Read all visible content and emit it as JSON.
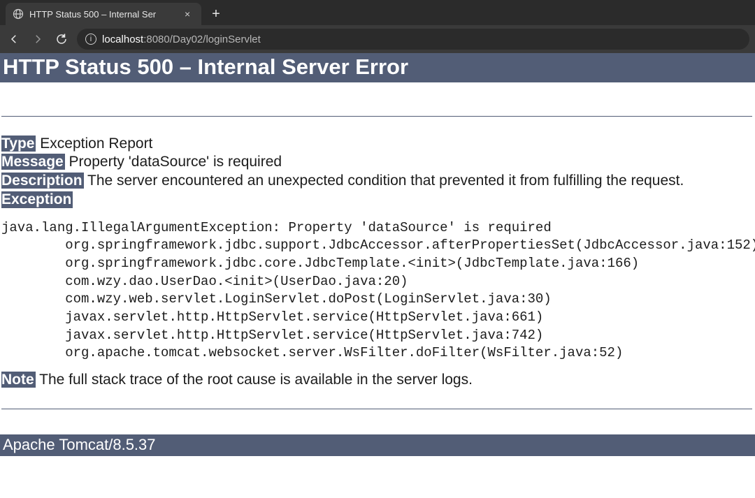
{
  "browser": {
    "tab_title": "HTTP Status 500 – Internal Ser",
    "url_host": "localhost",
    "url_port": ":8080",
    "url_path": "/Day02/loginServlet"
  },
  "page": {
    "h1": "HTTP Status 500 – Internal Server Error",
    "type_label": "Type",
    "type_value": " Exception Report",
    "message_label": "Message",
    "message_value": " Property 'dataSource' is required",
    "description_label": "Description",
    "description_value": " The server encountered an unexpected condition that prevented it from fulfilling the request.",
    "exception_label": "Exception",
    "stack_trace": "java.lang.IllegalArgumentException: Property 'dataSource' is required\n\torg.springframework.jdbc.support.JdbcAccessor.afterPropertiesSet(JdbcAccessor.java:152)\n\torg.springframework.jdbc.core.JdbcTemplate.<init>(JdbcTemplate.java:166)\n\tcom.wzy.dao.UserDao.<init>(UserDao.java:20)\n\tcom.wzy.web.servlet.LoginServlet.doPost(LoginServlet.java:30)\n\tjavax.servlet.http.HttpServlet.service(HttpServlet.java:661)\n\tjavax.servlet.http.HttpServlet.service(HttpServlet.java:742)\n\torg.apache.tomcat.websocket.server.WsFilter.doFilter(WsFilter.java:52)",
    "note_label": "Note",
    "note_value": " The full stack trace of the root cause is available in the server logs.",
    "footer": "Apache Tomcat/8.5.37"
  }
}
